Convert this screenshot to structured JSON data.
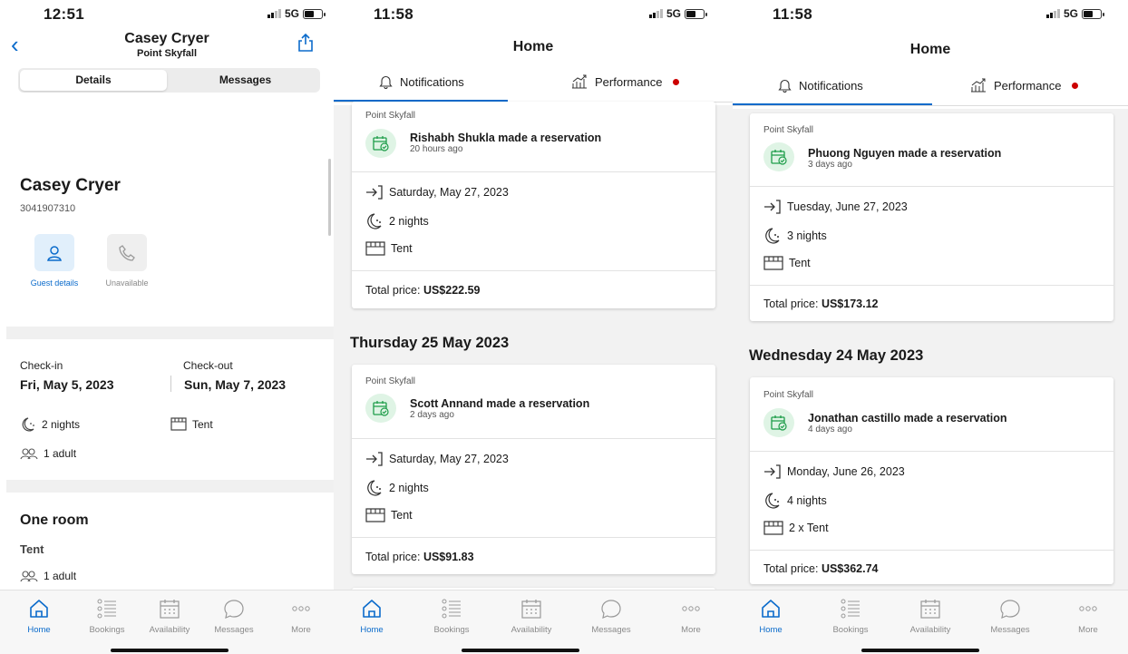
{
  "screen1": {
    "status_time": "12:51",
    "status_net": "5G",
    "header_title": "Casey Cryer",
    "header_subtitle": "Point Skyfall",
    "tab_details": "Details",
    "tab_messages": "Messages",
    "guest_name": "Casey Cryer",
    "guest_phone": "3041907310",
    "action_guest": "Guest details",
    "action_unavailable": "Unavailable",
    "checkin_label": "Check-in",
    "checkin_value": "Fri, May 5, 2023",
    "checkout_label": "Check-out",
    "checkout_value": "Sun, May 7, 2023",
    "nights": "2 nights",
    "unit": "Tent",
    "guests": "1 adult",
    "room_heading": "One room",
    "room_type": "Tent",
    "room_guests": "1 adult"
  },
  "screen2": {
    "status_time": "11:58",
    "status_net": "5G",
    "title": "Home",
    "tab_notifications": "Notifications",
    "tab_performance": "Performance",
    "cards": [
      {
        "property": "Point Skyfall",
        "title": "Rishabh Shukla made a reservation",
        "ago": "20 hours ago",
        "date": "Saturday, May 27, 2023",
        "nights": "2 nights",
        "unit": "Tent",
        "total_label": "Total price:",
        "total_value": "US$222.59"
      },
      {
        "property": "Point Skyfall",
        "title": "Scott  Annand made a reservation",
        "ago": "2 days ago",
        "date": "Saturday, May 27, 2023",
        "nights": "2 nights",
        "unit": "Tent",
        "total_label": "Total price:",
        "total_value": "US$91.83"
      }
    ],
    "day_heading": "Thursday 25 May 2023"
  },
  "screen3": {
    "status_time": "11:58",
    "status_net": "5G",
    "title": "Home",
    "tab_notifications": "Notifications",
    "tab_performance": "Performance",
    "cards": [
      {
        "property": "Point Skyfall",
        "title": "Phuong Nguyen made a reservation",
        "ago": "3 days ago",
        "date": "Tuesday, June 27, 2023",
        "nights": "3 nights",
        "unit": "Tent",
        "total_label": "Total price:",
        "total_value": "US$173.12"
      },
      {
        "property": "Point Skyfall",
        "title": "Jonathan castillo made a reservation",
        "ago": "4 days ago",
        "date": "Monday, June 26, 2023",
        "nights": "4 nights",
        "unit": "2 x Tent",
        "total_label": "Total price:",
        "total_value": "US$362.74"
      }
    ],
    "day_heading": "Wednesday 24 May 2023"
  },
  "nav": {
    "home": "Home",
    "bookings": "Bookings",
    "availability": "Availability",
    "messages": "Messages",
    "more": "More"
  },
  "colors": {
    "accent": "#0b6bcb",
    "alert_dot": "#cc0000",
    "reservation_icon_bg": "#dff4e5",
    "reservation_icon": "#1f9d4a"
  }
}
